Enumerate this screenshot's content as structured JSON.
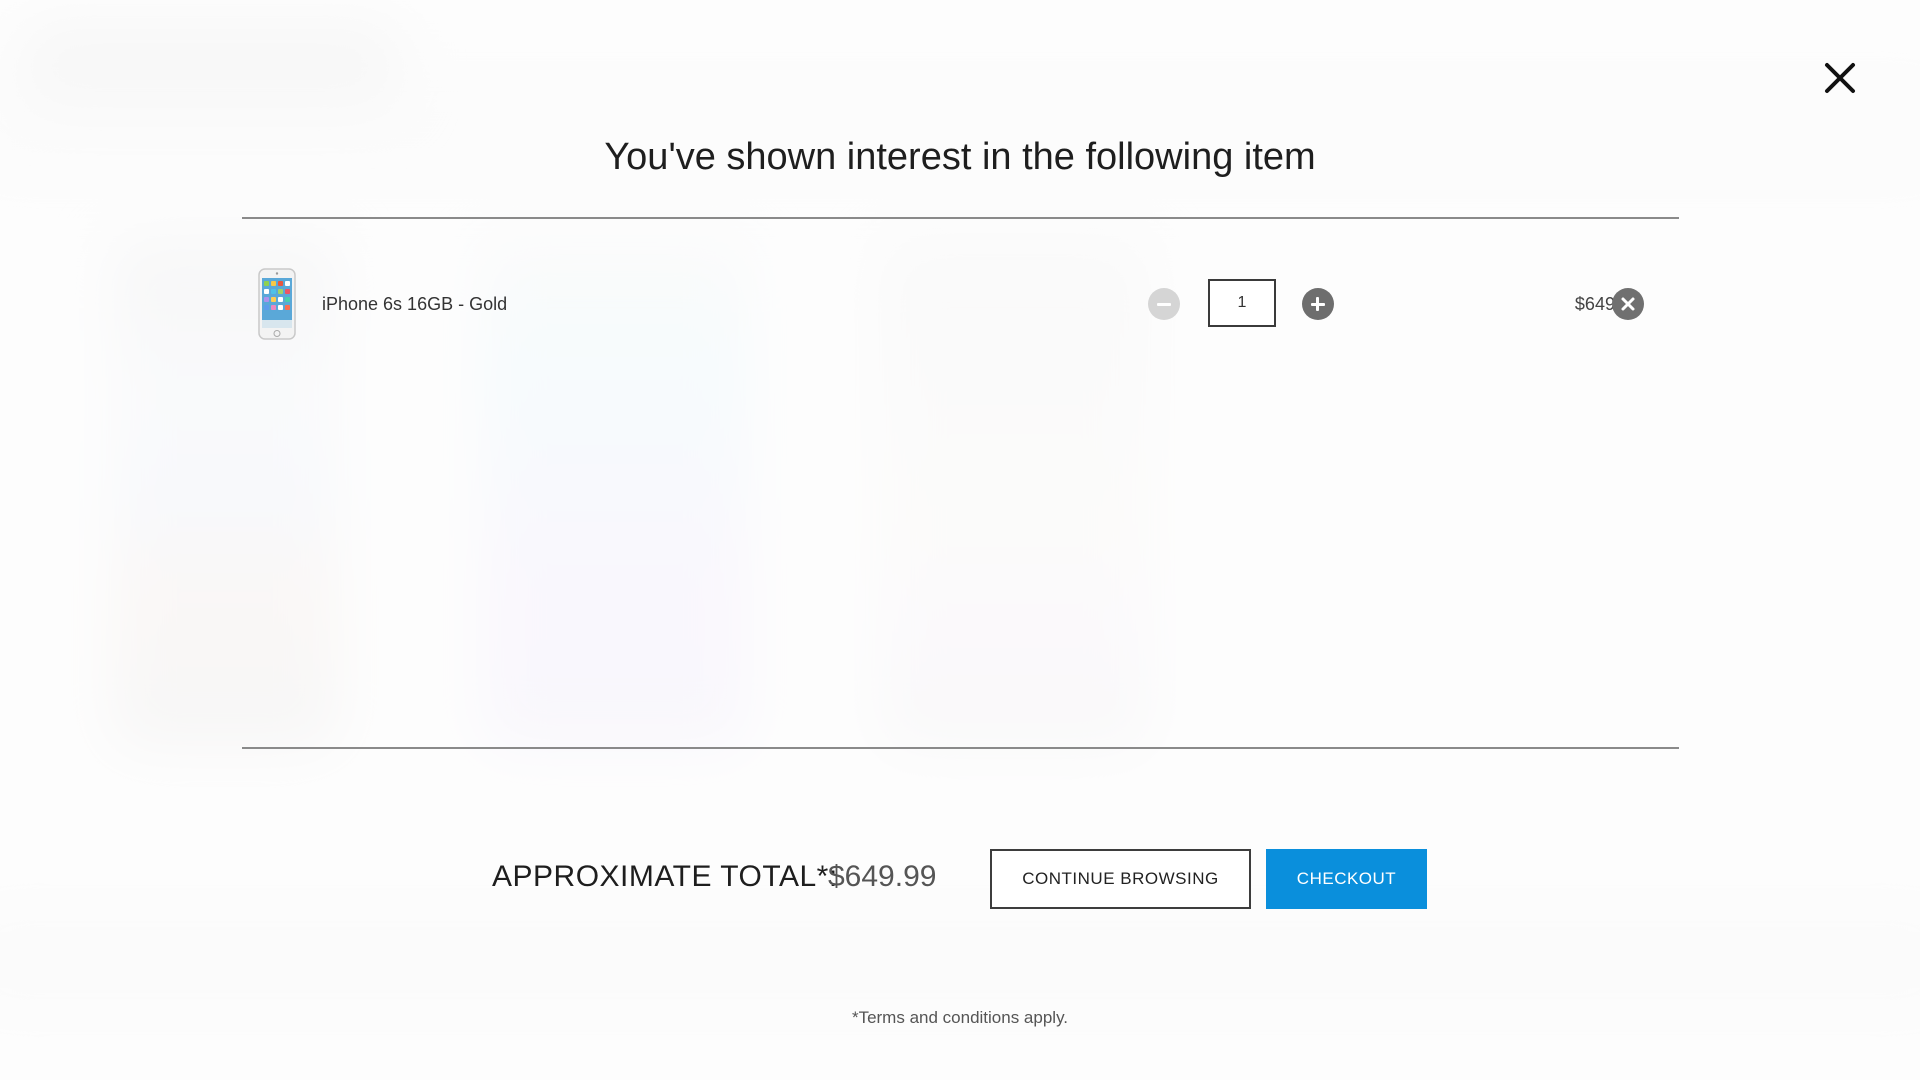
{
  "modal": {
    "title": "You've shown interest in the following item",
    "close_icon": "close-icon"
  },
  "cart": {
    "items": [
      {
        "name": "iPhone 6s 16GB - Gold",
        "quantity": "1",
        "price": "$649.99",
        "thumbnail_icon": "phone-thumbnail-icon",
        "minus_icon": "minus-circle-icon",
        "plus_icon": "plus-circle-icon",
        "remove_icon": "remove-circle-icon"
      }
    ]
  },
  "summary": {
    "total_label": "APPROXIMATE TOTAL*:",
    "total_amount": "$649.99",
    "continue_label": "CONTINUE BROWSING",
    "checkout_label": "CHECKOUT",
    "terms": "*Terms and conditions apply."
  },
  "colors": {
    "accent": "#0a8fdc",
    "minus_disabled": "#d5d5d5",
    "icon_gray": "#6e6e6e"
  }
}
